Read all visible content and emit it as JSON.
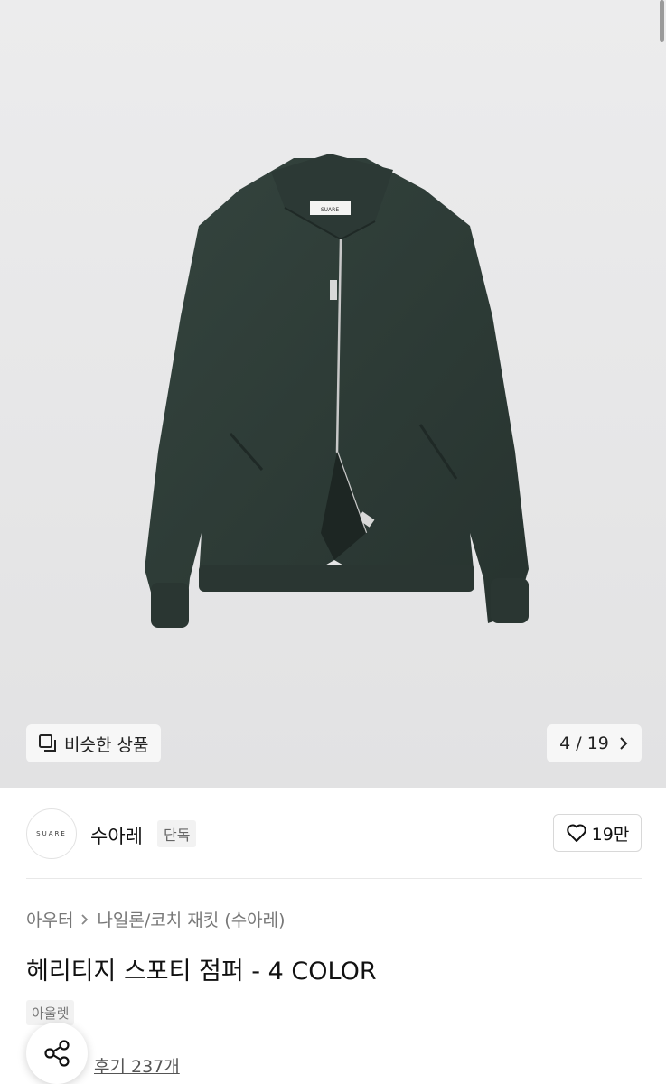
{
  "gallery": {
    "brand_label_on_image": "SUARE",
    "similar_label": "비슷한 상품",
    "counter": "4 / 19",
    "current_index": 4,
    "total": 19
  },
  "brand": {
    "logo_text": "SUARE",
    "name": "수아레",
    "badge": "단독",
    "likes": "19만"
  },
  "breadcrumb": {
    "category": "아우터",
    "subcategory": "나일론/코치 재킷 (수아레)"
  },
  "product": {
    "title": "헤리티지 스포티 점퍼 - 4 COLOR",
    "tag": "아울렛",
    "reviews": "후기 237개"
  },
  "colors": {
    "jacket": "#2f3d38",
    "background": "#e8e8e9"
  },
  "icons": [
    "copy-icon",
    "chevron-right-icon",
    "heart-icon",
    "share-icon"
  ]
}
